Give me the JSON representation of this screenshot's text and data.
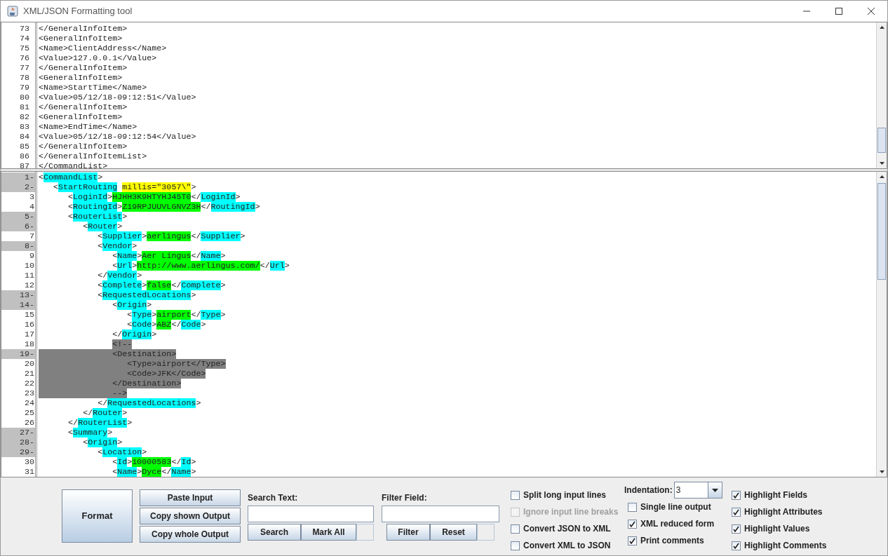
{
  "window": {
    "title": "XML/JSON Formatting tool"
  },
  "input_editor": {
    "lines": [
      {
        "number": "73",
        "text": "</GeneralInfoItem>"
      },
      {
        "number": "74",
        "text": "<GeneralInfoItem>"
      },
      {
        "number": "75",
        "text": "<Name>ClientAddress</Name>"
      },
      {
        "number": "76",
        "text": "<Value>127.0.0.1</Value>"
      },
      {
        "number": "77",
        "text": "</GeneralInfoItem>"
      },
      {
        "number": "78",
        "text": "<GeneralInfoItem>"
      },
      {
        "number": "79",
        "text": "<Name>StartTime</Name>"
      },
      {
        "number": "80",
        "text": "<Value>05/12/18-09:12:51</Value>"
      },
      {
        "number": "81",
        "text": "</GeneralInfoItem>"
      },
      {
        "number": "82",
        "text": "<GeneralInfoItem>"
      },
      {
        "number": "83",
        "text": "<Name>EndTime</Name>"
      },
      {
        "number": "84",
        "text": "<Value>05/12/18-09:12:54</Value>"
      },
      {
        "number": "85",
        "text": "</GeneralInfoItem>"
      },
      {
        "number": "86",
        "text": "</GeneralInfoItemList>"
      },
      {
        "number": "87",
        "text": "</CommandList>"
      }
    ]
  },
  "output_editor": {
    "lines": [
      {
        "number": "1-",
        "foldable": true,
        "segments": [
          {
            "kind": "plain",
            "text": "<"
          },
          {
            "kind": "field",
            "text": "CommandList"
          },
          {
            "kind": "plain",
            "text": ">"
          }
        ]
      },
      {
        "number": "2-",
        "foldable": true,
        "segments": [
          {
            "kind": "plain",
            "text": "   <"
          },
          {
            "kind": "field",
            "text": "StartRouting"
          },
          {
            "kind": "attribute",
            "text": " millis=\"3057\\\""
          },
          {
            "kind": "plain",
            "text": ">"
          }
        ]
      },
      {
        "number": "3",
        "foldable": false,
        "segments": [
          {
            "kind": "plain",
            "text": "      <"
          },
          {
            "kind": "field",
            "text": "LoginId"
          },
          {
            "kind": "plain",
            "text": ">"
          },
          {
            "kind": "value",
            "text": "HJHH3K9HTYHJ45T0"
          },
          {
            "kind": "plain",
            "text": "</"
          },
          {
            "kind": "field",
            "text": "LoginId"
          },
          {
            "kind": "plain",
            "text": ">"
          }
        ]
      },
      {
        "number": "4",
        "foldable": false,
        "segments": [
          {
            "kind": "plain",
            "text": "      <"
          },
          {
            "kind": "field",
            "text": "RoutingId"
          },
          {
            "kind": "plain",
            "text": ">"
          },
          {
            "kind": "value",
            "text": "Z19RPJUUVLGNVZ3H"
          },
          {
            "kind": "plain",
            "text": "</"
          },
          {
            "kind": "field",
            "text": "RoutingId"
          },
          {
            "kind": "plain",
            "text": ">"
          }
        ]
      },
      {
        "number": "5-",
        "foldable": true,
        "segments": [
          {
            "kind": "plain",
            "text": "      <"
          },
          {
            "kind": "field",
            "text": "RouterList"
          },
          {
            "kind": "plain",
            "text": ">"
          }
        ]
      },
      {
        "number": "6-",
        "foldable": true,
        "segments": [
          {
            "kind": "plain",
            "text": "         <"
          },
          {
            "kind": "field",
            "text": "Router"
          },
          {
            "kind": "plain",
            "text": ">"
          }
        ]
      },
      {
        "number": "7",
        "foldable": false,
        "segments": [
          {
            "kind": "plain",
            "text": "            <"
          },
          {
            "kind": "field",
            "text": "Supplier"
          },
          {
            "kind": "plain",
            "text": ">"
          },
          {
            "kind": "value",
            "text": "aerlingus"
          },
          {
            "kind": "plain",
            "text": "</"
          },
          {
            "kind": "field",
            "text": "Supplier"
          },
          {
            "kind": "plain",
            "text": ">"
          }
        ]
      },
      {
        "number": "8-",
        "foldable": true,
        "segments": [
          {
            "kind": "plain",
            "text": "            <"
          },
          {
            "kind": "field",
            "text": "Vendor"
          },
          {
            "kind": "plain",
            "text": ">"
          }
        ]
      },
      {
        "number": "9",
        "foldable": false,
        "segments": [
          {
            "kind": "plain",
            "text": "               <"
          },
          {
            "kind": "field",
            "text": "Name"
          },
          {
            "kind": "plain",
            "text": ">"
          },
          {
            "kind": "value",
            "text": "Aer Lingus"
          },
          {
            "kind": "plain",
            "text": "</"
          },
          {
            "kind": "field",
            "text": "Name"
          },
          {
            "kind": "plain",
            "text": ">"
          }
        ]
      },
      {
        "number": "10",
        "foldable": false,
        "segments": [
          {
            "kind": "plain",
            "text": "               <"
          },
          {
            "kind": "field",
            "text": "Url"
          },
          {
            "kind": "plain",
            "text": ">"
          },
          {
            "kind": "value",
            "text": "http://www.aerlingus.com/"
          },
          {
            "kind": "plain",
            "text": "</"
          },
          {
            "kind": "field",
            "text": "Url"
          },
          {
            "kind": "plain",
            "text": ">"
          }
        ]
      },
      {
        "number": "11",
        "foldable": false,
        "segments": [
          {
            "kind": "plain",
            "text": "            </"
          },
          {
            "kind": "field",
            "text": "Vendor"
          },
          {
            "kind": "plain",
            "text": ">"
          }
        ]
      },
      {
        "number": "12",
        "foldable": false,
        "segments": [
          {
            "kind": "plain",
            "text": "            <"
          },
          {
            "kind": "field",
            "text": "Complete"
          },
          {
            "kind": "plain",
            "text": ">"
          },
          {
            "kind": "value",
            "text": "false"
          },
          {
            "kind": "plain",
            "text": "</"
          },
          {
            "kind": "field",
            "text": "Complete"
          },
          {
            "kind": "plain",
            "text": ">"
          }
        ]
      },
      {
        "number": "13-",
        "foldable": true,
        "segments": [
          {
            "kind": "plain",
            "text": "            <"
          },
          {
            "kind": "field",
            "text": "RequestedLocations"
          },
          {
            "kind": "plain",
            "text": ">"
          }
        ]
      },
      {
        "number": "14-",
        "foldable": true,
        "segments": [
          {
            "kind": "plain",
            "text": "               <"
          },
          {
            "kind": "field",
            "text": "Origin"
          },
          {
            "kind": "plain",
            "text": ">"
          }
        ]
      },
      {
        "number": "15",
        "foldable": false,
        "segments": [
          {
            "kind": "plain",
            "text": "                  <"
          },
          {
            "kind": "field",
            "text": "Type"
          },
          {
            "kind": "plain",
            "text": ">"
          },
          {
            "kind": "value",
            "text": "airport"
          },
          {
            "kind": "plain",
            "text": "</"
          },
          {
            "kind": "field",
            "text": "Type"
          },
          {
            "kind": "plain",
            "text": ">"
          }
        ]
      },
      {
        "number": "16",
        "foldable": false,
        "segments": [
          {
            "kind": "plain",
            "text": "                  <"
          },
          {
            "kind": "field",
            "text": "Code"
          },
          {
            "kind": "plain",
            "text": ">"
          },
          {
            "kind": "value",
            "text": "ABZ"
          },
          {
            "kind": "plain",
            "text": "</"
          },
          {
            "kind": "field",
            "text": "Code"
          },
          {
            "kind": "plain",
            "text": ">"
          }
        ]
      },
      {
        "number": "17",
        "foldable": false,
        "segments": [
          {
            "kind": "plain",
            "text": "               </"
          },
          {
            "kind": "field",
            "text": "Origin"
          },
          {
            "kind": "plain",
            "text": ">"
          }
        ]
      },
      {
        "number": "18",
        "foldable": false,
        "segments": [
          {
            "kind": "comment",
            "text": "               <!--"
          }
        ]
      },
      {
        "number": "19-",
        "foldable": true,
        "segments": [
          {
            "kind": "comment_block",
            "text": "               <Destination>"
          }
        ]
      },
      {
        "number": "20",
        "foldable": false,
        "segments": [
          {
            "kind": "comment_block",
            "text": "                  <Type>airport</Type>"
          }
        ]
      },
      {
        "number": "21",
        "foldable": false,
        "segments": [
          {
            "kind": "comment_block",
            "text": "                  <Code>JFK</Code>"
          }
        ]
      },
      {
        "number": "22",
        "foldable": false,
        "segments": [
          {
            "kind": "comment_block",
            "text": "               </Destination>"
          }
        ]
      },
      {
        "number": "23",
        "foldable": false,
        "segments": [
          {
            "kind": "comment_block",
            "text": "               -->"
          }
        ]
      },
      {
        "number": "24",
        "foldable": false,
        "segments": [
          {
            "kind": "plain",
            "text": "            </"
          },
          {
            "kind": "field",
            "text": "RequestedLocations"
          },
          {
            "kind": "plain",
            "text": ">"
          }
        ]
      },
      {
        "number": "25",
        "foldable": false,
        "segments": [
          {
            "kind": "plain",
            "text": "         </"
          },
          {
            "kind": "field",
            "text": "Router"
          },
          {
            "kind": "plain",
            "text": ">"
          }
        ]
      },
      {
        "number": "26",
        "foldable": false,
        "segments": [
          {
            "kind": "plain",
            "text": "      </"
          },
          {
            "kind": "field",
            "text": "RouterList"
          },
          {
            "kind": "plain",
            "text": ">"
          }
        ]
      },
      {
        "number": "27-",
        "foldable": true,
        "segments": [
          {
            "kind": "plain",
            "text": "      <"
          },
          {
            "kind": "field",
            "text": "Summary"
          },
          {
            "kind": "plain",
            "text": ">"
          }
        ]
      },
      {
        "number": "28-",
        "foldable": true,
        "segments": [
          {
            "kind": "plain",
            "text": "         <"
          },
          {
            "kind": "field",
            "text": "Origin"
          },
          {
            "kind": "plain",
            "text": ">"
          }
        ]
      },
      {
        "number": "29-",
        "foldable": true,
        "segments": [
          {
            "kind": "plain",
            "text": "            <"
          },
          {
            "kind": "field",
            "text": "Location"
          },
          {
            "kind": "plain",
            "text": ">"
          }
        ]
      },
      {
        "number": "30",
        "foldable": false,
        "segments": [
          {
            "kind": "plain",
            "text": "               <"
          },
          {
            "kind": "field",
            "text": "Id"
          },
          {
            "kind": "plain",
            "text": ">"
          },
          {
            "kind": "value",
            "text": "10000583"
          },
          {
            "kind": "plain",
            "text": "</"
          },
          {
            "kind": "field",
            "text": "Id"
          },
          {
            "kind": "plain",
            "text": ">"
          }
        ]
      },
      {
        "number": "31",
        "foldable": false,
        "segments": [
          {
            "kind": "plain",
            "text": "               <"
          },
          {
            "kind": "field",
            "text": "Name"
          },
          {
            "kind": "plain",
            "text": ">"
          },
          {
            "kind": "value",
            "text": "Dyce"
          },
          {
            "kind": "plain",
            "text": "</"
          },
          {
            "kind": "field",
            "text": "Name"
          },
          {
            "kind": "plain",
            "text": ">"
          }
        ]
      }
    ]
  },
  "controls": {
    "format_button": "Format",
    "action_buttons": [
      "Paste Input",
      "Copy shown Output",
      "Copy whole Output"
    ],
    "search": {
      "label": "Search Text:",
      "buttons": [
        "Search",
        "Mark All"
      ]
    },
    "filter": {
      "label": "Filter Field:",
      "buttons": [
        "Filter",
        "Reset"
      ]
    },
    "options_column_1": [
      {
        "label": "Split long input lines",
        "checked": false,
        "disabled": false
      },
      {
        "label": "Ignore input line breaks",
        "checked": false,
        "disabled": true
      },
      {
        "label": "Convert JSON to XML",
        "checked": false,
        "disabled": false
      },
      {
        "label": "Convert XML to JSON",
        "checked": false,
        "disabled": false
      }
    ],
    "indentation": {
      "label": "Indentation:",
      "value": "3"
    },
    "options_column_2": [
      {
        "label": "Single line output",
        "checked": false,
        "disabled": false
      },
      {
        "label": "XML reduced form",
        "checked": true,
        "disabled": false
      },
      {
        "label": "Print comments",
        "checked": true,
        "disabled": false
      }
    ],
    "options_column_3": [
      {
        "label": "Highlight Fields",
        "checked": true,
        "disabled": false
      },
      {
        "label": "Highlight Attributes",
        "checked": true,
        "disabled": false
      },
      {
        "label": "Highlight Values",
        "checked": true,
        "disabled": false
      },
      {
        "label": "Highlight Comments",
        "checked": true,
        "disabled": false
      }
    ]
  }
}
